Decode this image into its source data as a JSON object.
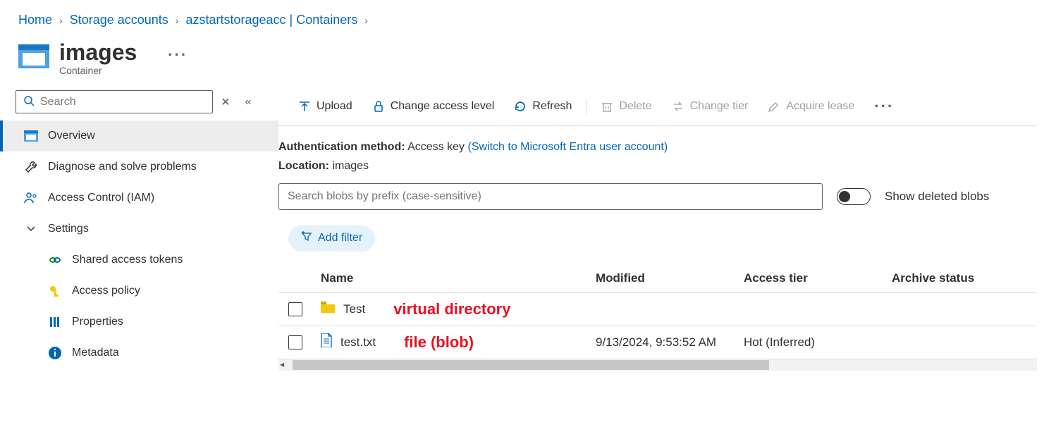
{
  "breadcrumb": [
    {
      "label": "Home"
    },
    {
      "label": "Storage accounts"
    },
    {
      "label": "azstartstorageacc | Containers"
    }
  ],
  "header": {
    "title": "images",
    "subtitle": "Container"
  },
  "sidebar": {
    "search_placeholder": "Search",
    "items": [
      {
        "label": "Overview"
      },
      {
        "label": "Diagnose and solve problems"
      },
      {
        "label": "Access Control (IAM)"
      },
      {
        "label": "Settings"
      }
    ],
    "sub_items": [
      {
        "label": "Shared access tokens"
      },
      {
        "label": "Access policy"
      },
      {
        "label": "Properties"
      },
      {
        "label": "Metadata"
      }
    ]
  },
  "toolbar": {
    "upload": "Upload",
    "change_access": "Change access level",
    "refresh": "Refresh",
    "delete": "Delete",
    "change_tier": "Change tier",
    "acquire_lease": "Acquire lease"
  },
  "info": {
    "auth_method_label": "Authentication method:",
    "auth_method_value": "Access key",
    "switch_link": "(Switch to Microsoft Entra user account)",
    "location_label": "Location:",
    "location_value": "images"
  },
  "filter": {
    "placeholder": "Search blobs by prefix (case-sensitive)",
    "toggle_label": "Show deleted blobs",
    "add_filter": "Add filter"
  },
  "table": {
    "columns": {
      "name": "Name",
      "modified": "Modified",
      "tier": "Access tier",
      "archive": "Archive status"
    },
    "rows": [
      {
        "name": "Test",
        "modified": "",
        "tier": "",
        "annotation": "virtual directory",
        "type": "folder"
      },
      {
        "name": "test.txt",
        "modified": "9/13/2024, 9:53:52 AM",
        "tier": "Hot (Inferred)",
        "annotation": "file (blob)",
        "type": "file"
      }
    ]
  }
}
